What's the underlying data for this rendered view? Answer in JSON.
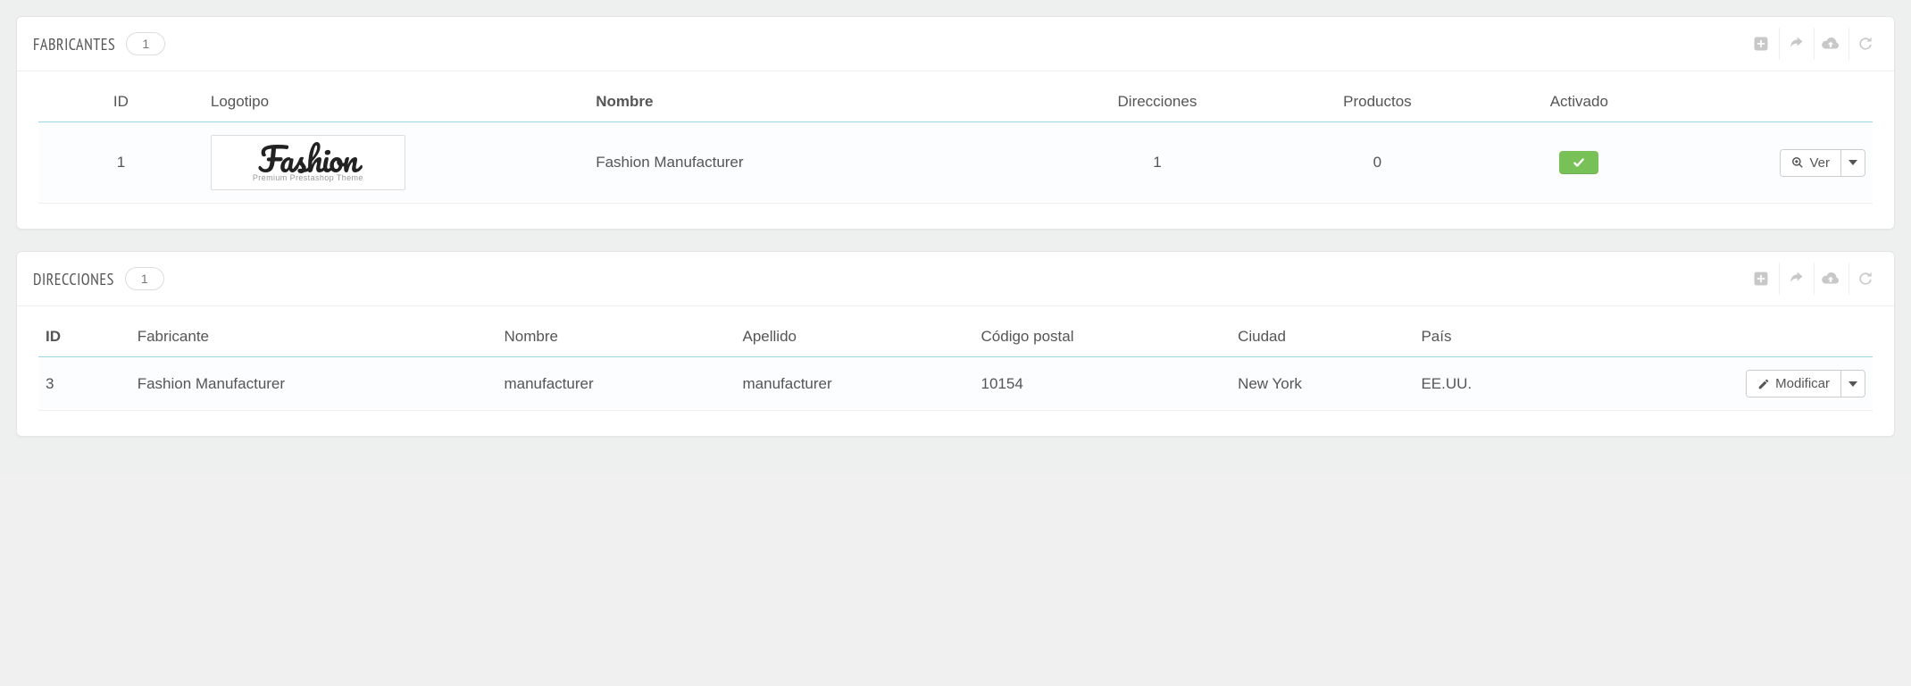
{
  "panels": {
    "manufacturers": {
      "title": "FABRICANTES",
      "count": "1",
      "columns": {
        "id": "ID",
        "logo": "Logotipo",
        "name": "Nombre",
        "addresses": "Direcciones",
        "products": "Productos",
        "active": "Activado"
      },
      "row": {
        "id": "1",
        "logo_main": "Fashion",
        "logo_sub": "Premium Prestashop Theme",
        "name": "Fashion Manufacturer",
        "addresses": "1",
        "products": "0",
        "active": true
      },
      "action_label": "Ver"
    },
    "addresses": {
      "title": "DIRECCIONES",
      "count": "1",
      "columns": {
        "id": "ID",
        "manufacturer": "Fabricante",
        "firstname": "Nombre",
        "lastname": "Apellido",
        "zip": "Código postal",
        "city": "Ciudad",
        "country": "País"
      },
      "row": {
        "id": "3",
        "manufacturer": "Fashion Manufacturer",
        "firstname": "manufacturer",
        "lastname": "manufacturer",
        "zip": "10154",
        "city": "New York",
        "country": "EE.UU."
      },
      "action_label": "Modificar"
    }
  }
}
